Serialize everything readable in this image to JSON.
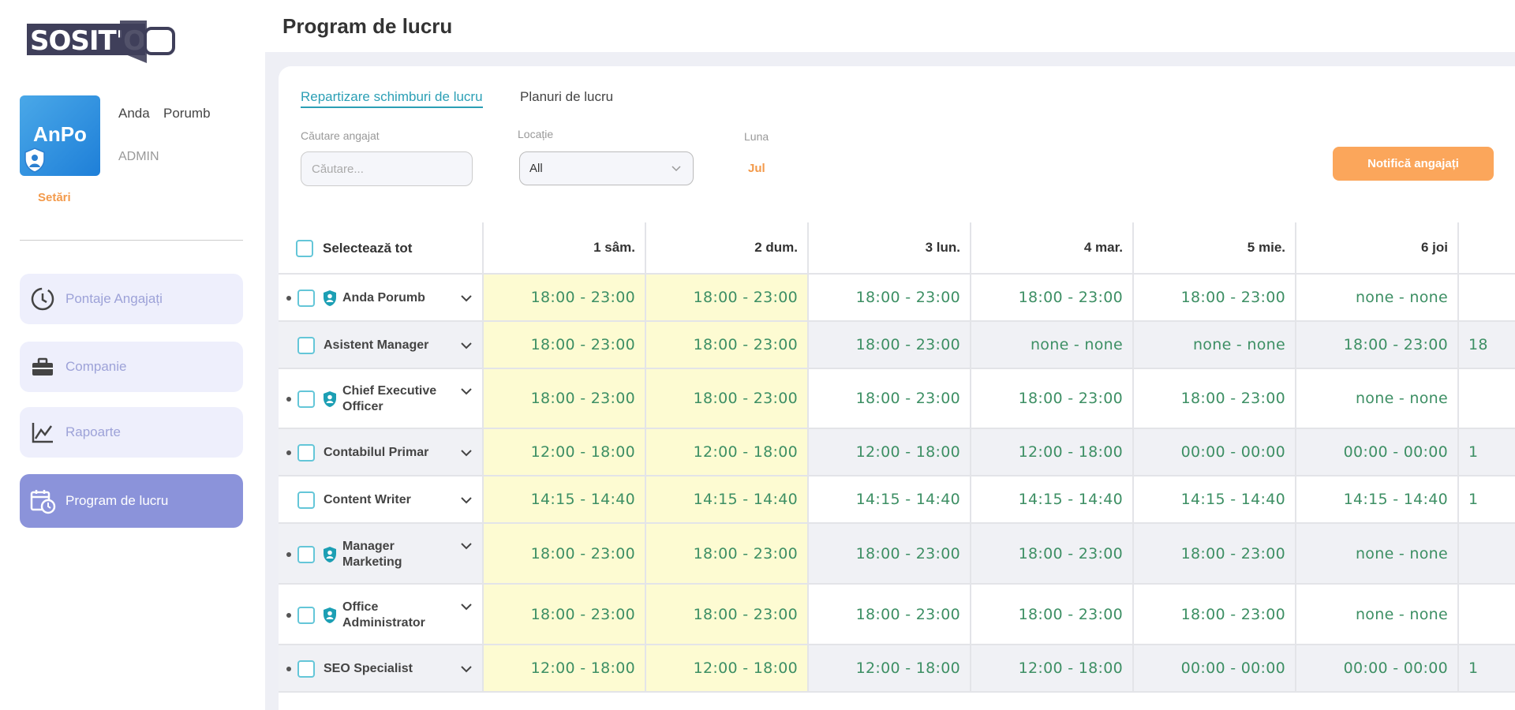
{
  "brand": {
    "logo_text": "SOSIT'O"
  },
  "user": {
    "initials": "AnPo",
    "first_name": "Anda",
    "last_name": "Porumb",
    "role": "ADMIN",
    "settings_label": "Setări"
  },
  "nav": [
    {
      "label": "Pontaje Angajați",
      "icon": "clock-icon",
      "active": false
    },
    {
      "label": "Companie",
      "icon": "toolbox-icon",
      "active": false
    },
    {
      "label": "Rapoarte",
      "icon": "chart-line-icon",
      "active": false
    },
    {
      "label": "Program de lucru",
      "icon": "calendar-clock-icon",
      "active": true
    }
  ],
  "page": {
    "title": "Program de lucru"
  },
  "tabs": {
    "active": "Repartizare schimburi de lucru",
    "inactive": "Planuri de lucru"
  },
  "filters": {
    "search_label": "Căutare angajat",
    "search_placeholder": "Căutare...",
    "search_value": "",
    "location_label": "Locație",
    "location_value": "All",
    "month_label": "Luna",
    "month_value": "Jul"
  },
  "notify_button": "Notifică angajați",
  "table": {
    "select_all": "Selectează tot",
    "days": [
      "1 sâm.",
      "2 dum.",
      "3 lun.",
      "4 mar.",
      "5 mie.",
      "6 joi"
    ],
    "rows": [
      {
        "name_lines": [
          "Anda Porumb"
        ],
        "bullet": true,
        "shield": true,
        "shifts": [
          "18:00 - 23:00",
          "18:00 - 23:00",
          "18:00 - 23:00",
          "18:00 - 23:00",
          "18:00 - 23:00",
          "none - none"
        ],
        "overflow": ""
      },
      {
        "name_lines": [
          "Asistent Manager"
        ],
        "bullet": false,
        "shield": false,
        "shifts": [
          "18:00 - 23:00",
          "18:00 - 23:00",
          "18:00 - 23:00",
          "none - none",
          "none - none",
          "18:00 - 23:00"
        ],
        "overflow": "18"
      },
      {
        "name_lines": [
          "Chief Executive",
          "Officer"
        ],
        "bullet": true,
        "shield": true,
        "shifts": [
          "18:00 - 23:00",
          "18:00 - 23:00",
          "18:00 - 23:00",
          "18:00 - 23:00",
          "18:00 - 23:00",
          "none - none"
        ],
        "overflow": ""
      },
      {
        "name_lines": [
          "Contabilul Primar"
        ],
        "bullet": true,
        "shield": false,
        "shifts": [
          "12:00 - 18:00",
          "12:00 - 18:00",
          "12:00 - 18:00",
          "12:00 - 18:00",
          "00:00 - 00:00",
          "00:00 - 00:00"
        ],
        "overflow": "1"
      },
      {
        "name_lines": [
          "Content Writer"
        ],
        "bullet": false,
        "shield": false,
        "shifts": [
          "14:15 - 14:40",
          "14:15 - 14:40",
          "14:15 - 14:40",
          "14:15 - 14:40",
          "14:15 - 14:40",
          "14:15 - 14:40"
        ],
        "overflow": "1"
      },
      {
        "name_lines": [
          "Manager",
          "Marketing"
        ],
        "bullet": true,
        "shield": true,
        "shifts": [
          "18:00 - 23:00",
          "18:00 - 23:00",
          "18:00 - 23:00",
          "18:00 - 23:00",
          "18:00 - 23:00",
          "none - none"
        ],
        "overflow": ""
      },
      {
        "name_lines": [
          "Office",
          "Administrator"
        ],
        "bullet": true,
        "shield": true,
        "shifts": [
          "18:00 - 23:00",
          "18:00 - 23:00",
          "18:00 - 23:00",
          "18:00 - 23:00",
          "18:00 - 23:00",
          "none - none"
        ],
        "overflow": ""
      },
      {
        "name_lines": [
          "SEO Specialist"
        ],
        "bullet": true,
        "shield": false,
        "shifts": [
          "12:00 - 18:00",
          "12:00 - 18:00",
          "12:00 - 18:00",
          "12:00 - 18:00",
          "00:00 - 00:00",
          "00:00 - 00:00"
        ],
        "overflow": "1"
      }
    ]
  },
  "colors": {
    "accent": "#2b9fb5",
    "orange": "#fba65b",
    "nav_active": "#8b93da",
    "shift_text": "#3d8f64",
    "weekend_bg": "#fdfbd2"
  }
}
